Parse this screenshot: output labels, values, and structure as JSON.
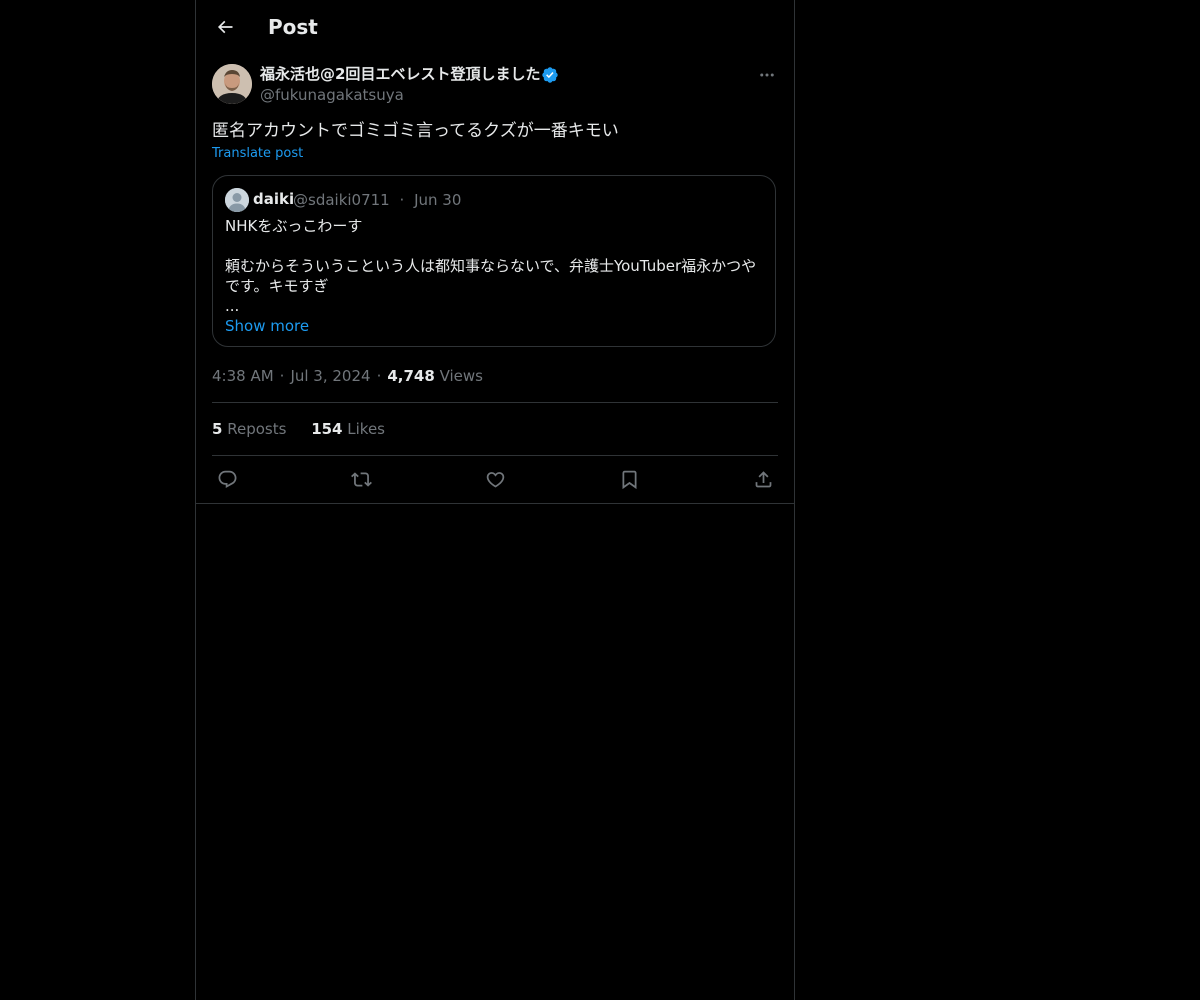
{
  "header": {
    "title": "Post"
  },
  "post": {
    "author_name": "福永活也@2回目エベレスト登頂しました",
    "author_handle": "@fukunagakatsuya",
    "verified": true,
    "text": "匿名アカウントでゴミゴミ言ってるクズが一番キモい",
    "translate_label": "Translate post",
    "time": "4:38 AM",
    "date": "Jul 3, 2024",
    "views_count": "4,748",
    "views_label": "Views"
  },
  "quote": {
    "name": "daiki",
    "handle": "@sdaiki0711",
    "separator": "·",
    "date": "Jun 30",
    "lines": [
      "NHKをぶっこわーす",
      "頼むからそういうこという人は都知事ならないで、弁護士YouTuber福永かつや",
      "です。キモすぎ",
      "..."
    ],
    "show_more": "Show more"
  },
  "stats": {
    "reposts_count": "5",
    "reposts_label": "Reposts",
    "likes_count": "154",
    "likes_label": "Likes"
  },
  "meta": {
    "separator": "·"
  },
  "icons": {
    "back": "arrow-left-icon",
    "more": "more-horizontal-icon",
    "reply": "reply-icon",
    "repost": "repost-icon",
    "like": "heart-icon",
    "bookmark": "bookmark-icon",
    "share": "share-icon",
    "verified": "verified-badge-icon"
  },
  "colors": {
    "background": "#000000",
    "text": "#e7e9ea",
    "secondary": "#71767b",
    "accent": "#1d9bf0",
    "border": "#2f3336"
  }
}
